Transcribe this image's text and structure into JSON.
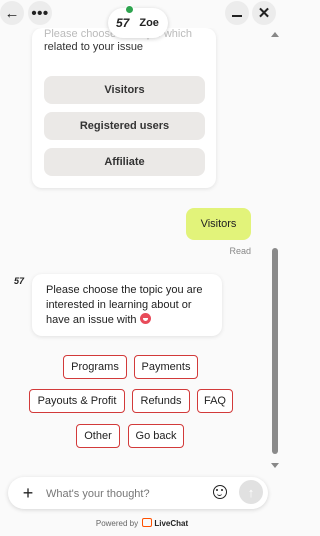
{
  "header": {
    "back_icon": "arrow-left-icon",
    "more_icon": "more-dots-icon",
    "minimize_icon": "minimize-icon",
    "close_icon": "close-icon",
    "agent_logo": "57",
    "agent_name": "Zoe",
    "agent_status_color": "#2ea44f"
  },
  "messages": {
    "topic_card": {
      "text_faded": "Please choose the topic which",
      "text": "related to your issue",
      "options": [
        "Visitors",
        "Registered users",
        "Affiliate"
      ]
    },
    "user_message": {
      "text": "Visitors",
      "status": "Read",
      "bubble_color": "#e2f37a"
    },
    "agent_logo": "57",
    "agent_message": {
      "text": "Please choose the topic you are interested in learning about or have an issue with",
      "emoji": "grinning-face-emoji"
    },
    "quick_replies": [
      "Programs",
      "Payments",
      "Payouts & Profit",
      "Refunds",
      "FAQ",
      "Other",
      "Go back"
    ]
  },
  "composer": {
    "placeholder": "What's your thought?",
    "plus_icon": "plus-icon",
    "emoji_icon": "smiley-icon",
    "send_icon": "send-arrow-icon"
  },
  "footer": {
    "powered_by": "Powered by",
    "brand": "LiveChat",
    "brand_color": "#ff5100"
  }
}
